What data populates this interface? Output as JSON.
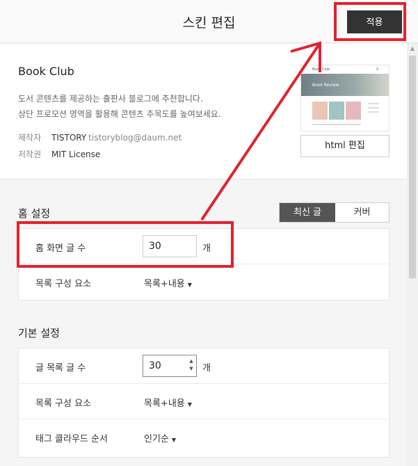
{
  "header": {
    "title": "스킨 편집",
    "apply_label": "적용"
  },
  "skin": {
    "name": "Book Club",
    "desc_line1": "도서 콘텐츠를 제공하는 출판사 블로그에 추천합니다.",
    "desc_line2": "상단 프로모션 영역을 활용해 콘텐츠 주목도를 높여보세요.",
    "author_label": "제작자",
    "author_name": "TISTORY",
    "author_email": "tistoryblog@daum.net",
    "license_label": "저작권",
    "license_value": "MIT License",
    "html_edit_label": "html 편집",
    "preview": {
      "blog_title": "Book Club",
      "hero_text": "Book Review"
    }
  },
  "home_settings": {
    "title": "홈 설정",
    "tabs": [
      {
        "label": "최신 글",
        "active": true
      },
      {
        "label": "커버",
        "active": false
      }
    ],
    "rows": {
      "post_count_label": "홈 화면 글 수",
      "post_count_value": "30",
      "post_count_unit": "개",
      "list_items_label": "목록 구성 요소",
      "list_items_value": "목록+내용"
    }
  },
  "basic_settings": {
    "title": "기본 설정",
    "rows": {
      "post_count_label": "글 목록 글 수",
      "post_count_value": "30",
      "post_count_unit": "개",
      "list_items_label": "목록 구성 요소",
      "list_items_value": "목록+내용",
      "tag_order_label": "태그 클라우드 순서",
      "tag_order_value": "인기순"
    }
  },
  "colors": {
    "annotation": "#e2222f",
    "button_dark": "#333333"
  }
}
